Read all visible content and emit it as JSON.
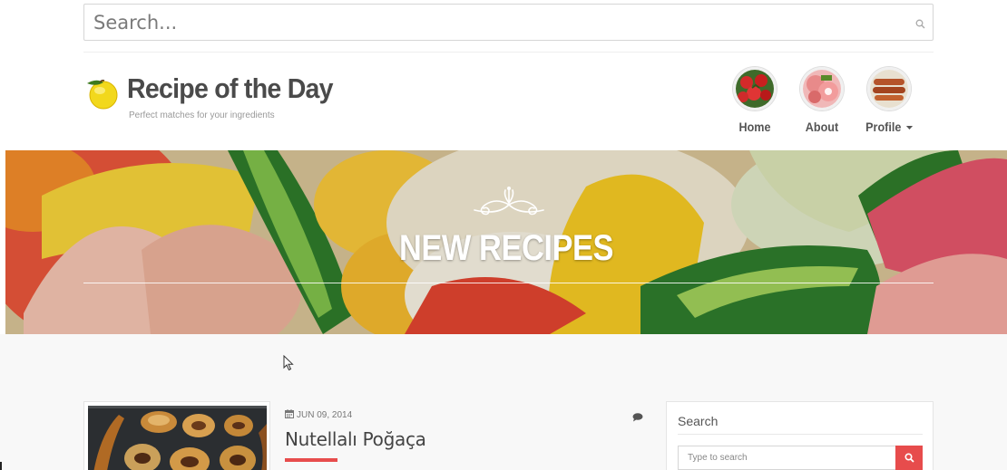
{
  "top_search": {
    "placeholder": "Search...",
    "icon": "search-icon"
  },
  "brand": {
    "title": "Recipe of the Day",
    "tagline": "Perfect matches for your ingredients",
    "logo_icon": "lemon-icon"
  },
  "nav": {
    "items": [
      {
        "label": "Home",
        "thumb": "strawberries"
      },
      {
        "label": "About",
        "thumb": "cold-cuts"
      },
      {
        "label": "Profile",
        "thumb": "sausages",
        "has_caret": true
      }
    ]
  },
  "hero": {
    "heading": "NEW RECIPES"
  },
  "post": {
    "date": "JUN 09, 2014",
    "title": "Nutellalı Poğaça",
    "comment_icon": "comment-icon",
    "accent_color": "#e74c4c"
  },
  "sidebar_widget": {
    "title": "Search",
    "input_placeholder": "Type to search",
    "button_icon": "search-icon",
    "button_color": "#e74c4c"
  }
}
